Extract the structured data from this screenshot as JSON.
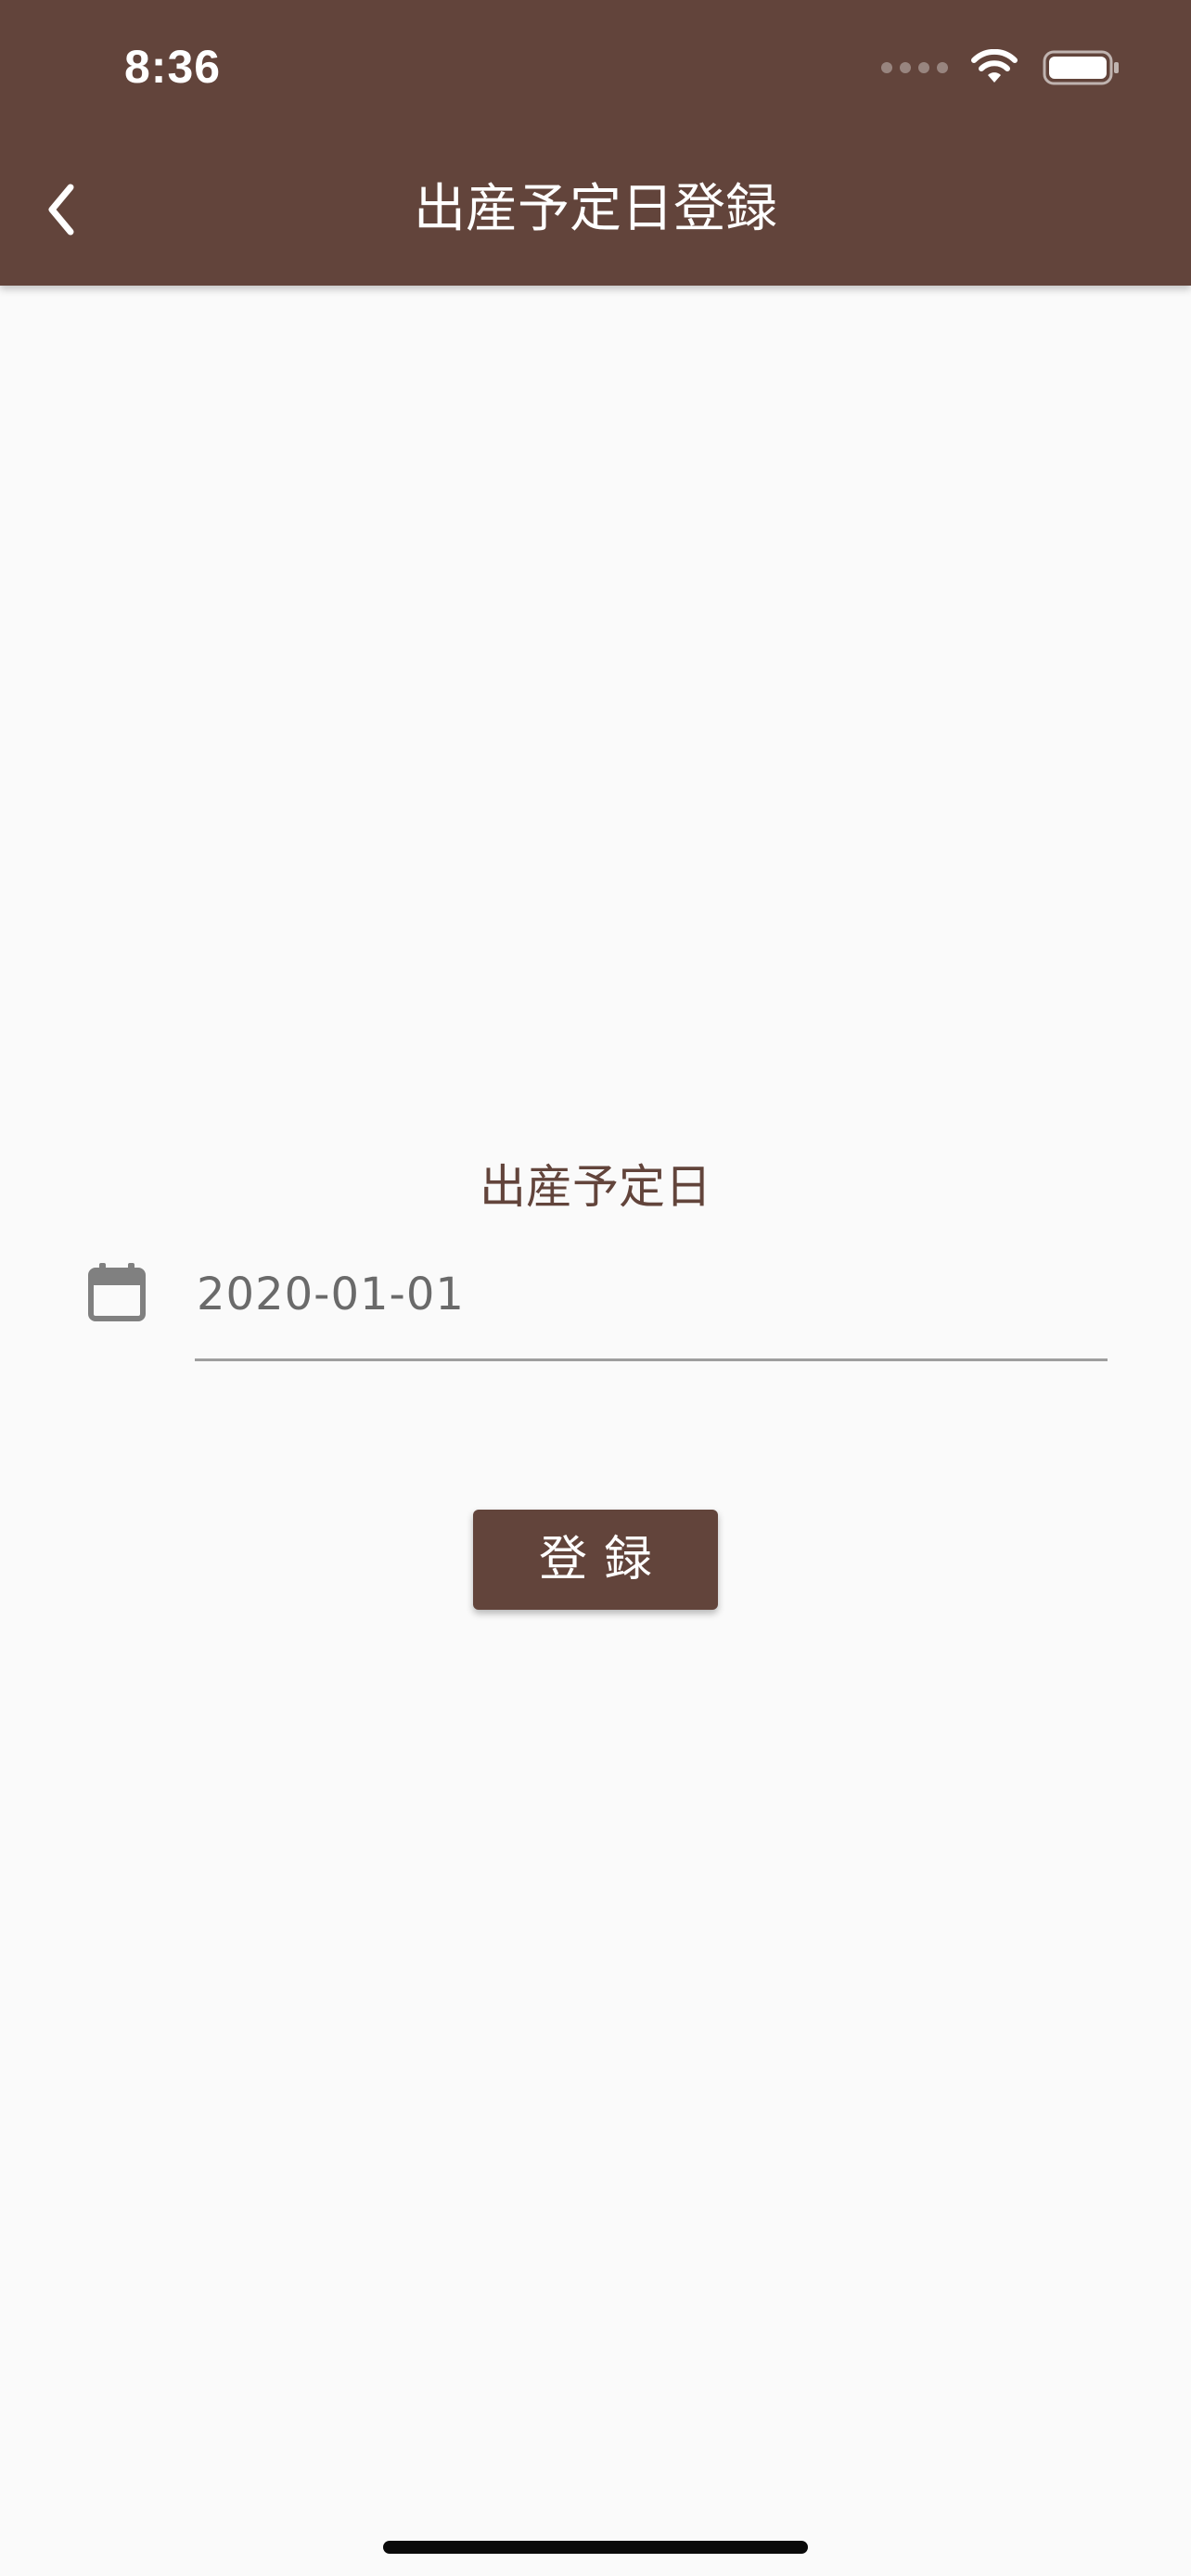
{
  "status_bar": {
    "time": "8:36",
    "icons": [
      "signal-dots-icon",
      "wifi-icon",
      "battery-icon"
    ]
  },
  "app_bar": {
    "title": "出産予定日登録",
    "back_icon": "chevron-left-icon",
    "background_color": "#62443b"
  },
  "form": {
    "label": "出産予定日",
    "date_icon": "calendar-icon",
    "date_value": "2020-01-01"
  },
  "actions": {
    "submit_label": "登録"
  },
  "colors": {
    "primary": "#62443b",
    "background": "#fafafa",
    "field_text": "#6a6a6a",
    "underline": "#9e9e9e"
  }
}
